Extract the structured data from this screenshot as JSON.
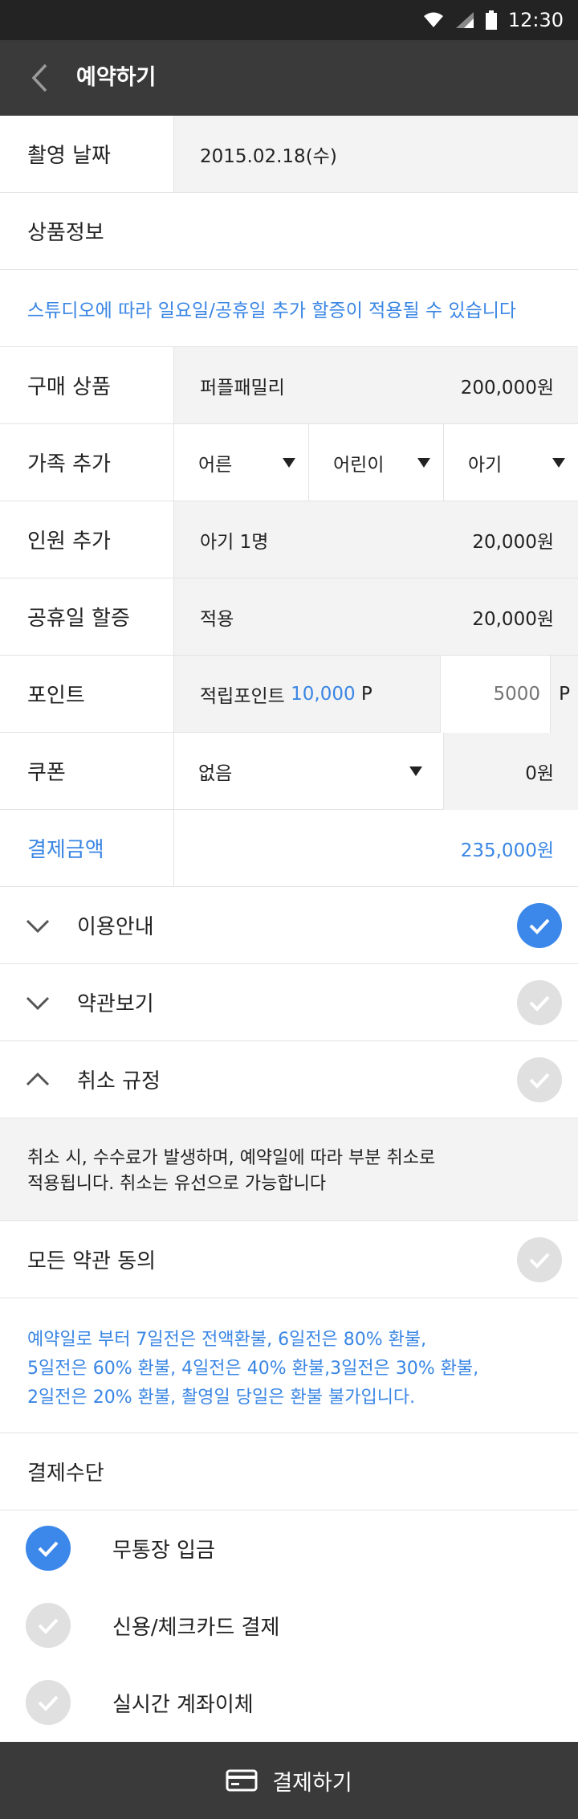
{
  "status_bar": {
    "time": "12:30"
  },
  "app_bar": {
    "title": "예약하기"
  },
  "shoot_date": {
    "label": "촬영 날짜",
    "value": "2015.02.18(수)"
  },
  "product_info": {
    "label": "상품정보"
  },
  "notice": "스튜디오에 따라 일요일/공휴일 추가 할증이 적용될 수 있습니다",
  "purchase": {
    "label": "구매 상품",
    "name": "퍼플패밀리",
    "price": "200,000원"
  },
  "family_add": {
    "label": "가족 추가",
    "options": [
      "어른",
      "어린이",
      "아기"
    ]
  },
  "person_add": {
    "label": "인원 추가",
    "value": "아기 1명",
    "price": "20,000원"
  },
  "holiday": {
    "label": "공휴일 할증",
    "value": "적용",
    "price": "20,000원"
  },
  "points": {
    "label": "포인트",
    "accum_label": "적립포인트",
    "accum_value": "10,000",
    "unit": "P",
    "input_placeholder": "5000"
  },
  "coupon": {
    "label": "쿠폰",
    "selected": "없음",
    "value": "0원"
  },
  "total": {
    "label": "결제금액",
    "value": "235,000원"
  },
  "accordions": [
    {
      "label": "이용안내",
      "checked": true
    },
    {
      "label": "약관보기",
      "checked": false
    },
    {
      "label": "취소 규정",
      "checked": false
    }
  ],
  "cancel_policy": {
    "line1": "취소 시, 수수료가 발생하며, 예약일에 따라 부분 취소로",
    "line2": "적용됩니다.  취소는 유선으로 가능합니다"
  },
  "agree_all": {
    "label": "모든 약관 동의",
    "checked": false
  },
  "refund_policy": {
    "line1": "예약일로 부터 7일전은 전액환불, 6일전은 80% 환불,",
    "line2": "5일전은 60% 환불, 4일전은 40% 환불,3일전은 30% 환불,",
    "line3": "2일전은 20% 환불, 촬영일 당일은 환불 불가입니다."
  },
  "payment_method": {
    "label": "결제수단",
    "options": [
      {
        "label": "무통장 입금",
        "checked": true
      },
      {
        "label": "신용/체크카드 결제",
        "checked": false
      },
      {
        "label": "실시간 계좌이체",
        "checked": false
      }
    ]
  },
  "pay_button": {
    "label": "결제하기"
  },
  "colors": {
    "accent": "#3a86e4",
    "bar": "#3a3a3a",
    "status_bar": "#232323",
    "cell_bg": "#f3f3f3",
    "check_off": "#e0e0e0"
  }
}
